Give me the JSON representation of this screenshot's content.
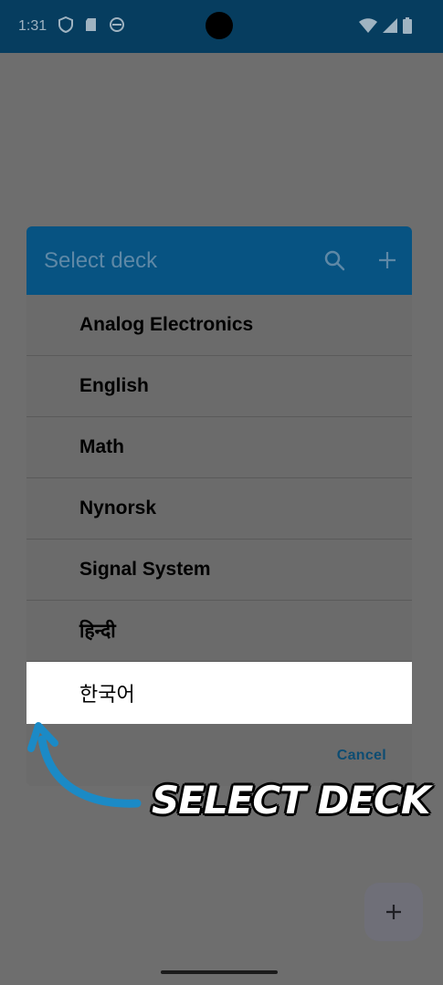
{
  "status_bar": {
    "time": "1:31",
    "icons_left": [
      "shield-icon",
      "sd-card-icon",
      "vpn-icon"
    ],
    "icons_right": [
      "wifi-icon",
      "signal-icon",
      "battery-icon"
    ]
  },
  "dialog": {
    "title": "Select deck",
    "header_icons": [
      "search-icon",
      "add-icon"
    ],
    "decks": [
      {
        "label": "Analog Electronics"
      },
      {
        "label": "English"
      },
      {
        "label": "Math"
      },
      {
        "label": "Nynorsk"
      },
      {
        "label": "Signal System"
      },
      {
        "label": "हिन्दी"
      },
      {
        "label": "한국어"
      }
    ],
    "cancel_label": "Cancel"
  },
  "annotation": {
    "text": "SELECT DECK",
    "color": "#1b8ac6"
  },
  "fab": {
    "icon": "add-icon"
  },
  "colors": {
    "header": "#075382",
    "status_bar": "#063d5f",
    "scrim": "#6e6e6e",
    "highlight": "#ffffff"
  }
}
